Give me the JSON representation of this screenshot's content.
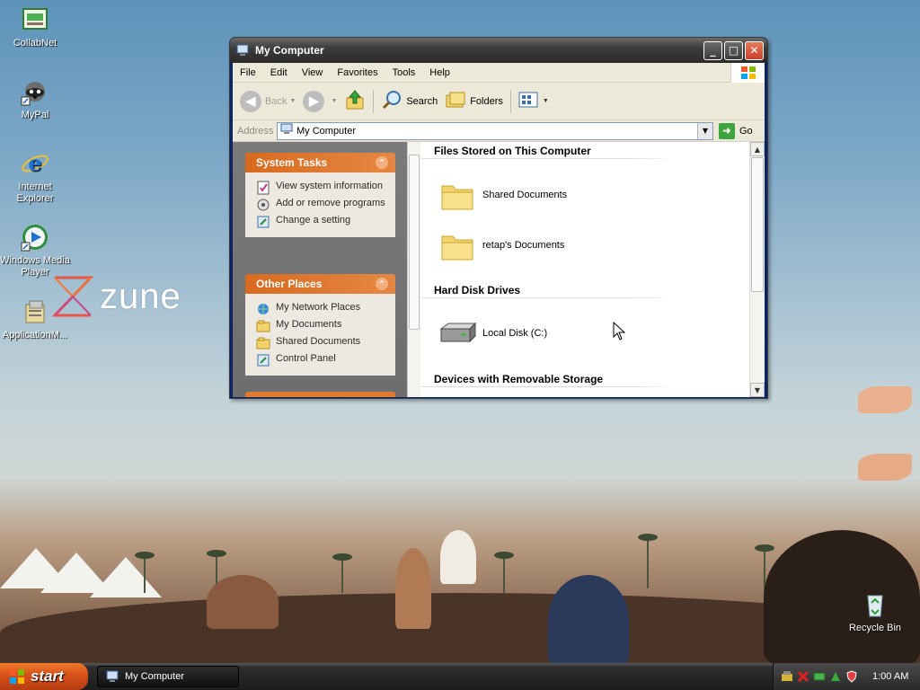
{
  "desktop": {
    "icons": [
      {
        "label": "CollabNet",
        "icon": "collabnet-icon"
      },
      {
        "label": "MyPal",
        "icon": "mypal-icon"
      },
      {
        "label": "Internet Explorer",
        "icon": "ie-icon"
      },
      {
        "label": "Windows Media Player",
        "icon": "wmp-icon"
      },
      {
        "label": "ApplicationM...",
        "icon": "application-icon"
      }
    ],
    "recycle_bin": "Recycle Bin",
    "zune_logo": "zune"
  },
  "window": {
    "title": "My Computer",
    "menu": [
      "File",
      "Edit",
      "View",
      "Favorites",
      "Tools",
      "Help"
    ],
    "toolbar": {
      "back": "Back",
      "search": "Search",
      "folders": "Folders"
    },
    "address": {
      "label": "Address",
      "value": "My Computer",
      "go": "Go"
    },
    "task_pane": {
      "system_tasks": {
        "title": "System Tasks",
        "links": [
          "View system information",
          "Add or remove programs",
          "Change a setting"
        ]
      },
      "other_places": {
        "title": "Other Places",
        "links": [
          "My Network Places",
          "My Documents",
          "Shared Documents",
          "Control Panel"
        ]
      }
    },
    "sections": {
      "files": {
        "title": "Files Stored on This Computer",
        "items": [
          "Shared Documents",
          "retap's Documents"
        ]
      },
      "drives": {
        "title": "Hard Disk Drives",
        "items": [
          "Local Disk (C:)"
        ]
      },
      "removable": {
        "title": "Devices with Removable Storage"
      }
    }
  },
  "taskbar": {
    "start": "start",
    "task": "My Computer",
    "clock": "1:00 AM"
  },
  "colors": {
    "accent_orange": "#d86a1e",
    "title_dark": "#2a2a2a",
    "menu_bg": "#ece9d8"
  }
}
